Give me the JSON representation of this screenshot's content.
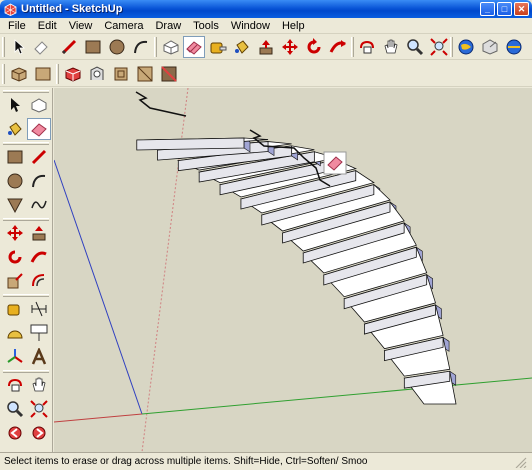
{
  "window": {
    "title": "Untitled - SketchUp"
  },
  "menu": [
    "File",
    "Edit",
    "View",
    "Camera",
    "Draw",
    "Tools",
    "Window",
    "Help"
  ],
  "toolbar_row1": [
    "select-icon",
    "eraser-icon",
    "line-icon",
    "rectangle-icon",
    "circle-icon",
    "arc-icon",
    "make-component-icon",
    "eraser-active-icon",
    "tape-measure-icon",
    "paint-bucket-icon",
    "push-pull-icon",
    "move-icon",
    "rotate-icon",
    "follow-me-icon",
    "orbit-icon",
    "pan-icon",
    "zoom-icon",
    "zoom-extents-icon",
    "get-models-icon",
    "share-model-icon",
    "share-component-icon"
  ],
  "toolbar_row2": [
    "x-ray-icon",
    "wireframe-icon",
    "hidden-line-icon",
    "shaded-icon",
    "shaded-textures-icon",
    "monochrome-icon",
    "iso-view-icon"
  ],
  "palette": [
    "select-icon",
    "make-component-icon",
    "paint-bucket-icon",
    "eraser-icon",
    "rectangle-icon",
    "line-icon",
    "circle-icon",
    "arc-icon",
    "polygon-icon",
    "freehand-icon",
    "move-icon",
    "push-pull-icon",
    "rotate-icon",
    "follow-me-icon",
    "scale-icon",
    "offset-icon",
    "tape-measure-icon",
    "dimension-icon",
    "protractor-icon",
    "text-icon",
    "axes-icon",
    "3d-text-icon",
    "orbit-icon",
    "pan-icon",
    "zoom-icon",
    "zoom-window-icon",
    "previous-view-icon",
    "next-view-icon"
  ],
  "status": {
    "message": "Select items to erase or drag across multiple items.  Shift=Hide, Ctrl=Soften/ Smoo"
  },
  "colors": {
    "titlebar": "#0a56d8",
    "viewport": "#d8d6c4",
    "step_top": "#ffffff",
    "step_riser": "#e6e6ec",
    "step_side": "#a0a4d4"
  }
}
